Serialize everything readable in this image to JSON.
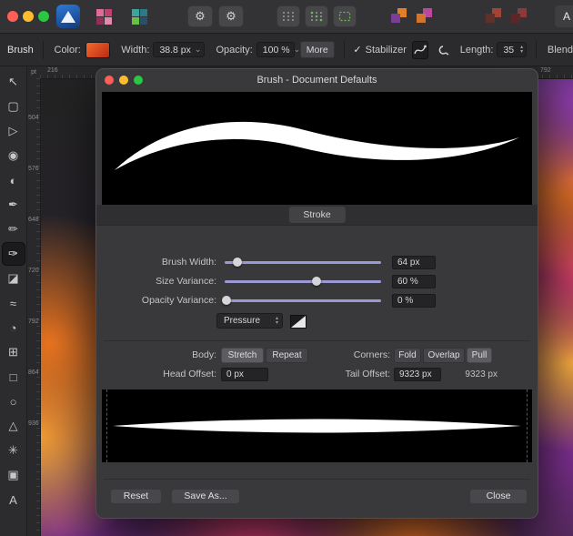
{
  "colors": {
    "traffic_red": "#ff5f57",
    "traffic_yellow": "#febc2e",
    "traffic_green": "#28c840",
    "slider_accent": "#9a99d4",
    "swatch_start": "#f4692e",
    "swatch_end": "#b82c12"
  },
  "glyphs": {
    "gear": "⚙",
    "chevron_down": "⌄",
    "stepper_up": "▴",
    "stepper_down": "▾",
    "check": "✓"
  },
  "top_toolbar": {
    "icons": [
      "app-logo",
      "pixel-grid",
      "layer-grid",
      "preferences-gear",
      "tool-settings-gear",
      "snap-grid",
      "snap-candidates",
      "snap-bounds",
      "order-forward",
      "order-backward",
      "insert-target-1",
      "insert-target-2"
    ],
    "partial_label": "A"
  },
  "context_toolbar": {
    "tool_name": "Brush",
    "color_label": "Color:",
    "width_label": "Width:",
    "width_value": "38.8 px",
    "opacity_label": "Opacity:",
    "opacity_value": "100 %",
    "more_button": "More",
    "stabilizer_label": "Stabilizer",
    "stabilizer_checked": true,
    "length_label": "Length:",
    "length_value": "35",
    "blend_label_partial": "Blend"
  },
  "rulers": {
    "unit": "pt",
    "horizontal_ticks": [
      "216",
      "792"
    ],
    "vertical_ticks": [
      "504",
      "576",
      "648",
      "720",
      "792",
      "864",
      "936"
    ]
  },
  "tools": {
    "items": [
      {
        "name": "move-tool",
        "glyph": "↖"
      },
      {
        "name": "artboard-tool",
        "glyph": "▢"
      },
      {
        "name": "node-tool",
        "glyph": "▷"
      },
      {
        "name": "fill-tool",
        "glyph": "◉"
      },
      {
        "name": "transparency-tool",
        "glyph": "◐"
      },
      {
        "name": "pen-tool",
        "glyph": "✒"
      },
      {
        "name": "pencil-tool",
        "glyph": "✏"
      },
      {
        "name": "vector-brush-tool",
        "glyph": "✑",
        "selected": true
      },
      {
        "name": "eraser-tool",
        "glyph": "◪"
      },
      {
        "name": "smudge-tool",
        "glyph": "≈"
      },
      {
        "name": "blur-tool",
        "glyph": "◔"
      },
      {
        "name": "crop-tool",
        "glyph": "⊞"
      },
      {
        "name": "rectangle-tool",
        "glyph": "□"
      },
      {
        "name": "ellipse-tool",
        "glyph": "○"
      },
      {
        "name": "shape-tool",
        "glyph": "△"
      },
      {
        "name": "flood-select-tool",
        "glyph": "✳"
      },
      {
        "name": "place-image-tool",
        "glyph": "▣"
      },
      {
        "name": "text-tool",
        "glyph": "A"
      }
    ]
  },
  "dialog": {
    "title": "Brush - Document Defaults",
    "tab_label": "Stroke",
    "sliders": [
      {
        "label": "Brush Width:",
        "value": "64 px",
        "percent": 8
      },
      {
        "label": "Size Variance:",
        "value": "60 %",
        "percent": 59
      },
      {
        "label": "Opacity Variance:",
        "value": "0 %",
        "percent": 1
      }
    ],
    "controller": {
      "value": "Pressure"
    },
    "body": {
      "label": "Body:",
      "options": [
        "Stretch",
        "Repeat"
      ],
      "selected": "Stretch"
    },
    "corners": {
      "label": "Corners:",
      "options": [
        "Fold",
        "Overlap",
        "Pull"
      ],
      "selected": "Pull"
    },
    "head_offset": {
      "label": "Head Offset:",
      "value": "0 px"
    },
    "tail_offset": {
      "label": "Tail Offset:",
      "value": "9323 px",
      "readout": "9323 px"
    },
    "footer": {
      "reset": "Reset",
      "save_as": "Save As...",
      "close": "Close"
    }
  }
}
